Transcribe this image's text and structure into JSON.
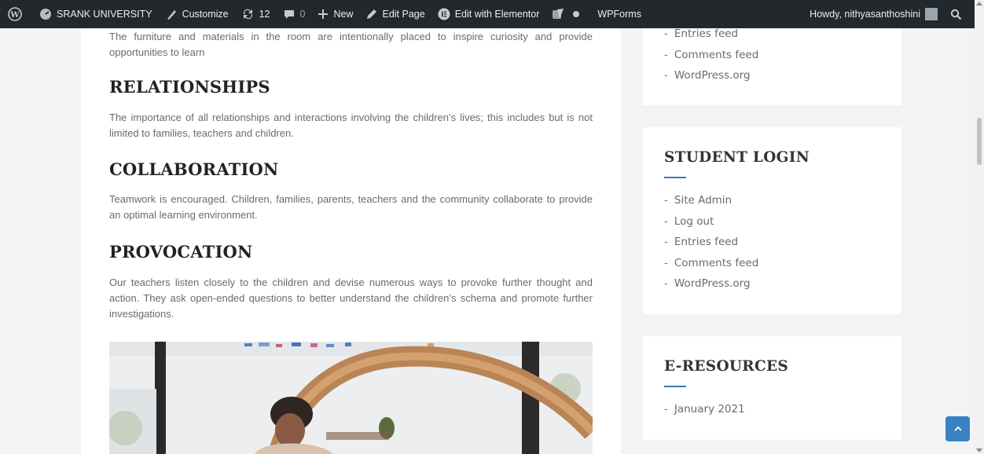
{
  "admin_bar": {
    "site_name": "SRANK UNIVERSITY",
    "customize": "Customize",
    "updates_count": "12",
    "comments_count": "0",
    "new": "New",
    "edit_page": "Edit Page",
    "edit_elementor": "Edit with Elementor",
    "wpforms": "WPForms",
    "howdy": "Howdy, nithyasanthoshini"
  },
  "content": {
    "intro_paragraph": "The furniture and materials in the room are intentionally placed to inspire curiosity and provide opportunities to learn",
    "sections": [
      {
        "heading": "RELATIONSHIPS",
        "text": "The importance of all relationships and interactions involving the children’s lives; this includes but is not limited to families, teachers and children."
      },
      {
        "heading": "COLLABORATION",
        "text": "Teamwork is encouraged. Children, families, parents, teachers and the community collaborate to provide an optimal learning environment."
      },
      {
        "heading": "PROVOCATION",
        "text": "Our teachers listen closely to the children and devise numerous ways to provoke further thought and action. They ask open-ended questions to better understand the children’s schema and promote further investigations."
      }
    ]
  },
  "sidebar": {
    "meta_widget": {
      "items": [
        "Entries feed",
        "Comments feed",
        "WordPress.org"
      ]
    },
    "student_login": {
      "title": "STUDENT LOGIN",
      "items": [
        "Site Admin",
        "Log out",
        "Entries feed",
        "Comments feed",
        "WordPress.org"
      ]
    },
    "e_resources": {
      "title": "E-RESOURCES",
      "items": [
        "January 2021"
      ]
    }
  },
  "colors": {
    "admin_bar_bg": "#23282d",
    "accent": "#3a78b6",
    "back_to_top": "#3a81c4"
  },
  "icons": {
    "wordpress": "wordpress-icon",
    "site": "dashboard-icon",
    "customize": "brush-icon",
    "updates": "refresh-icon",
    "comments": "comment-icon",
    "new": "plus-icon",
    "edit": "pencil-icon",
    "elementor": "elementor-icon",
    "yoast": "yoast-icon",
    "status": "dot-icon",
    "search": "search-icon",
    "back_to_top": "chevron-up-icon"
  }
}
